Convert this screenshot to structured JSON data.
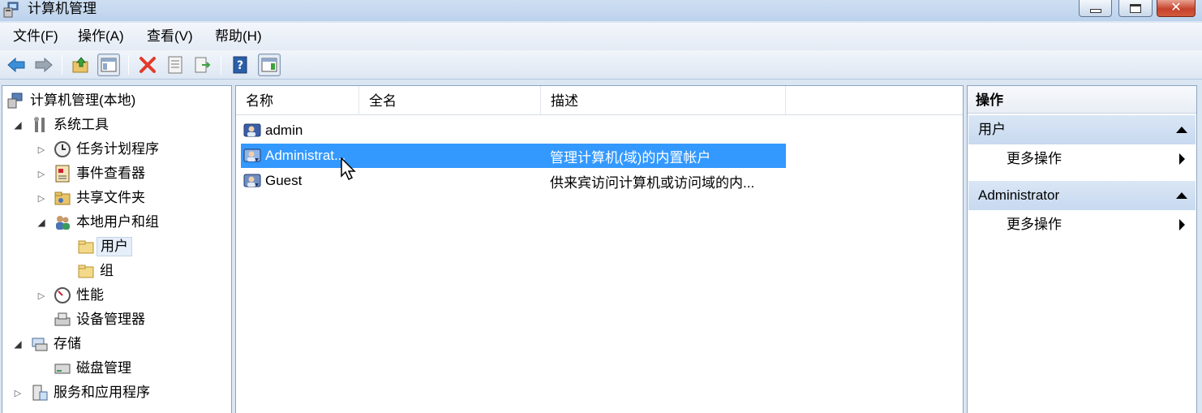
{
  "window": {
    "title": "计算机管理",
    "close_glyph": "✕"
  },
  "menu": [
    "文件(F)",
    "操作(A)",
    "查看(V)",
    "帮助(H)"
  ],
  "toolbar": {
    "buttons": [
      "back-icon",
      "forward-icon",
      "up-folder-icon",
      "show-hide-tree-icon",
      "delete-icon",
      "properties-icon",
      "export-list-icon",
      "help-icon",
      "show-hide-action-pane-icon"
    ]
  },
  "tree": {
    "root": "计算机管理(本地)",
    "system_tools": "系统工具",
    "task_scheduler": "任务计划程序",
    "event_viewer": "事件查看器",
    "shared_folders": "共享文件夹",
    "local_users_groups": "本地用户和组",
    "users": "用户",
    "groups": "组",
    "performance": "性能",
    "device_manager": "设备管理器",
    "storage": "存储",
    "disk_management": "磁盘管理",
    "services_apps": "服务和应用程序"
  },
  "list": {
    "columns": [
      "名称",
      "全名",
      "描述"
    ],
    "rows": [
      {
        "name": "admin",
        "fullname": "",
        "description": ""
      },
      {
        "name": "Administrat...",
        "fullname": "",
        "description": "管理计算机(域)的内置帐户",
        "selected": true
      },
      {
        "name": "Guest",
        "fullname": "",
        "description": "供来宾访问计算机或访问域的内..."
      }
    ]
  },
  "actions": {
    "title": "操作",
    "sections": [
      {
        "header": "用户",
        "item": "更多操作"
      },
      {
        "header": "Administrator",
        "item": "更多操作"
      }
    ]
  },
  "colors": {
    "selection": "#3399ff",
    "pane_border": "#8ea4c0"
  }
}
